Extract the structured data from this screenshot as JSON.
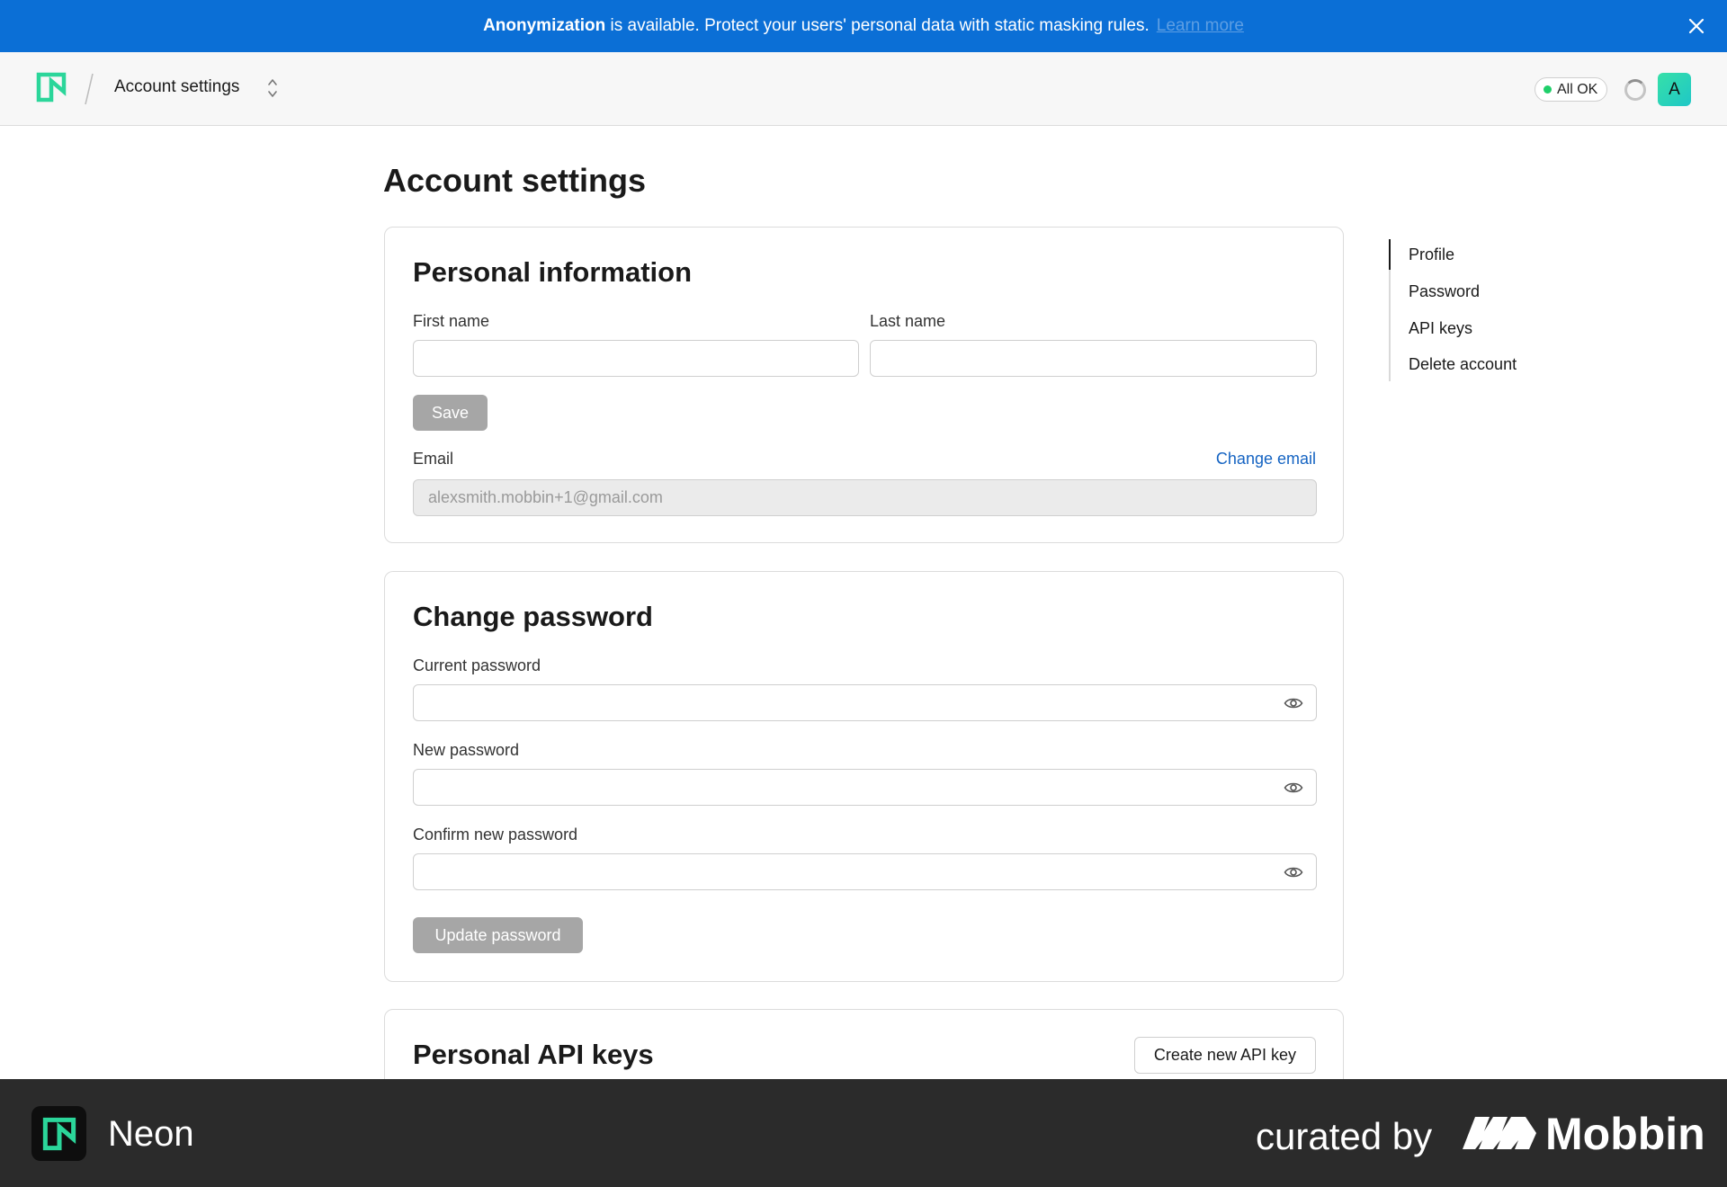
{
  "banner": {
    "bold": "Anonymization",
    "text": " is available. Protect your users' personal data with static masking rules.",
    "link": "Learn more",
    "bg_color": "#0b6fd6"
  },
  "topbar": {
    "breadcrumb": "Account settings",
    "status": "All OK",
    "status_color": "#1fcf6a",
    "avatar_initial": "A"
  },
  "page": {
    "title": "Account settings"
  },
  "personal_info": {
    "title": "Personal information",
    "first_name_label": "First name",
    "first_name_value": "",
    "last_name_label": "Last name",
    "last_name_value": "",
    "save_label": "Save",
    "email_label": "Email",
    "change_email_label": "Change email",
    "email_value": "alexsmith.mobbin+1@gmail.com"
  },
  "change_password": {
    "title": "Change password",
    "current_label": "Current password",
    "new_label": "New password",
    "confirm_label": "Confirm new password",
    "update_label": "Update password"
  },
  "api_keys": {
    "title": "Personal API keys",
    "create_label": "Create new API key"
  },
  "toc": {
    "items": [
      {
        "label": "Profile"
      },
      {
        "label": "Password"
      },
      {
        "label": "API keys"
      },
      {
        "label": "Delete account"
      }
    ]
  },
  "footer": {
    "brand": "Neon",
    "curated": "curated by",
    "mobbin": "Mobbin"
  }
}
